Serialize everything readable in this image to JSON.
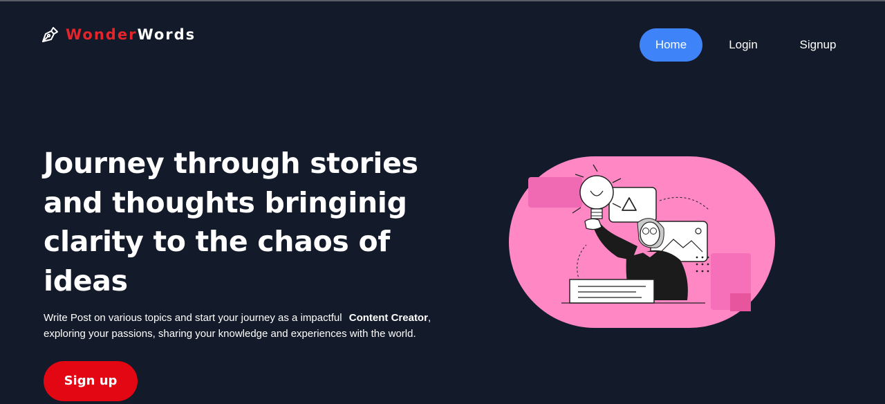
{
  "brand": {
    "name_part1": "Wonder",
    "name_part2": "Words",
    "icon": "pen-nib-icon"
  },
  "nav": {
    "items": [
      {
        "label": "Home",
        "active": true
      },
      {
        "label": "Login",
        "active": false
      },
      {
        "label": "Signup",
        "active": false
      }
    ]
  },
  "hero": {
    "headline_lines": [
      "Journey through stories",
      "and thoughts bringinig",
      "clarity to the chaos of",
      "ideas"
    ],
    "subtext_part1": "Write Post on various topics and start your journey as a impactful",
    "subtext_highlight": "Content Creator",
    "subtext_part2": ",",
    "subtext_line2": "exploring your passions, sharing your knowledge and experiences with the world.",
    "cta_label": "Sign up",
    "illustration": "woman-holding-lightbulb-illustration"
  },
  "colors": {
    "background": "#131a29",
    "brand_red": "#e5242c",
    "home_button": "#3f83f8",
    "cta": "#e30613",
    "illustration_pink": "#ff87c4"
  }
}
